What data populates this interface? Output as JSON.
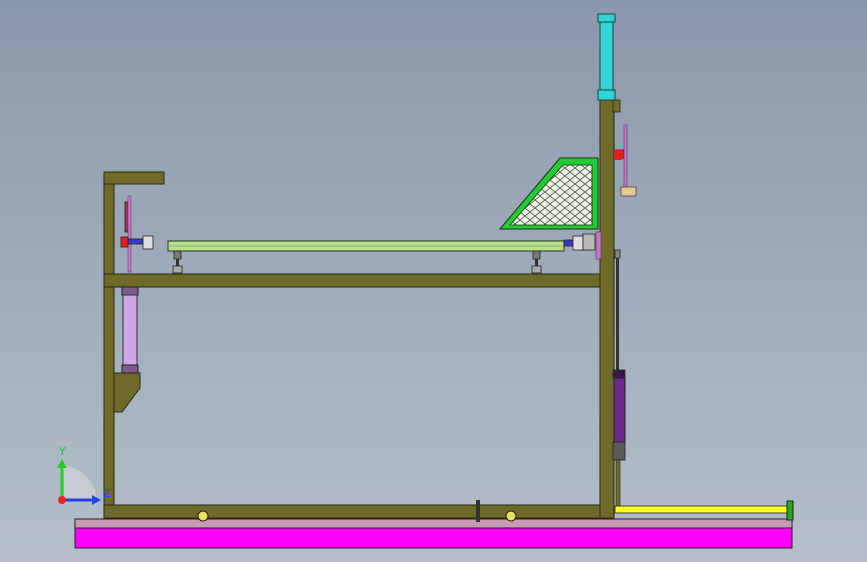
{
  "viewport": {
    "background_top": "#8a98ab",
    "background_bottom": "#b4bfca"
  },
  "colors": {
    "frame": "#6e6a2a",
    "frame_stroke": "#2a2a10",
    "base_plate": "#ff00ff",
    "base_plate_top": "#c89ab2",
    "cylinder_cyan": "#33d6d6",
    "platform_green": "#b8e08a",
    "mesh_green": "#22cc33",
    "rail_yellow": "#ffff22",
    "cylinder_purple": "#6a2a8a",
    "cylinder_lavender": "#cfa6e6",
    "red_part": "#e02020",
    "tan_part": "#e6c890",
    "blue_part": "#3a3ac8"
  },
  "triad": {
    "y_label": "Y",
    "z_label": "Z",
    "y_color": "#22cc22",
    "z_color": "#2244ee",
    "origin_color": "#ee2222"
  }
}
